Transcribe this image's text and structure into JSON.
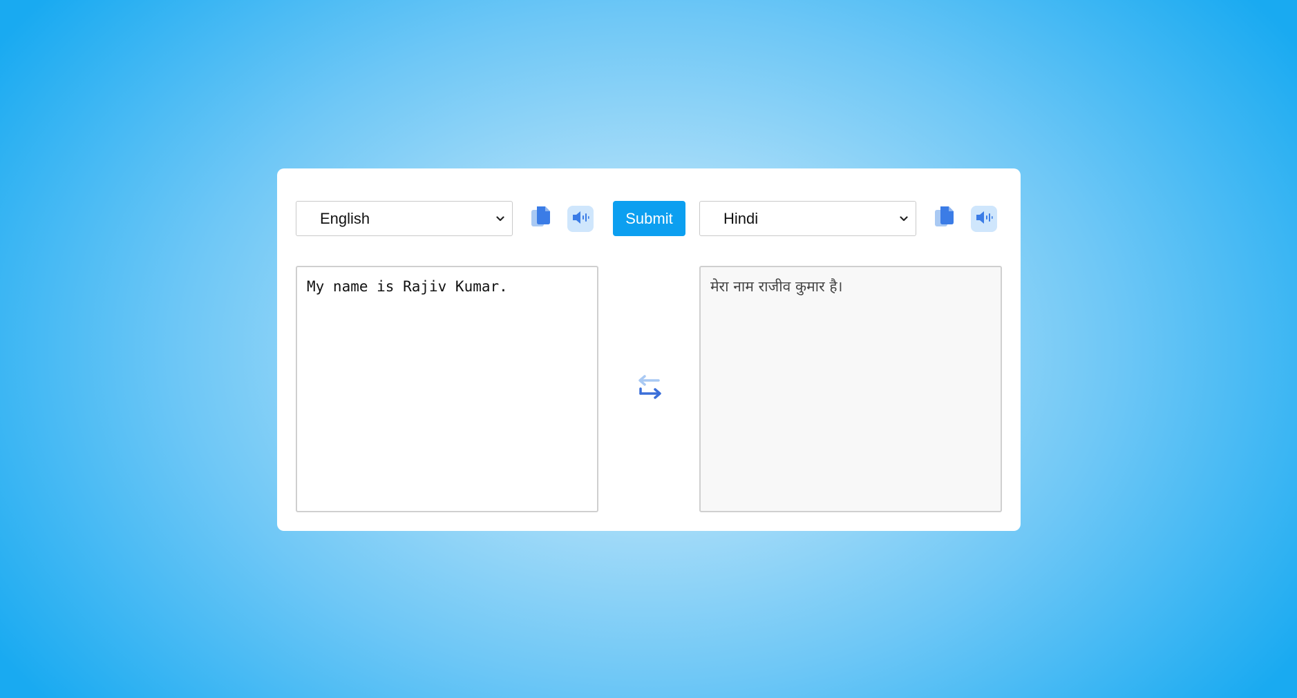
{
  "source": {
    "language": "English",
    "text": "My name is Rajiv Kumar."
  },
  "target": {
    "language": "Hindi",
    "text": "मेरा नाम राजीव कुमार है।"
  },
  "toolbar": {
    "submit_label": "Submit"
  },
  "icons": {
    "copy": "copy-icon",
    "speak": "speaker-icon",
    "swap": "swap-arrows-icon",
    "dropdown": "chevron-down-icon"
  },
  "colors": {
    "accent": "#0c9ff0",
    "icon_blue": "#3b7ce6",
    "icon_light": "#a9c9f3",
    "speak_bg": "#cfe6fc"
  }
}
